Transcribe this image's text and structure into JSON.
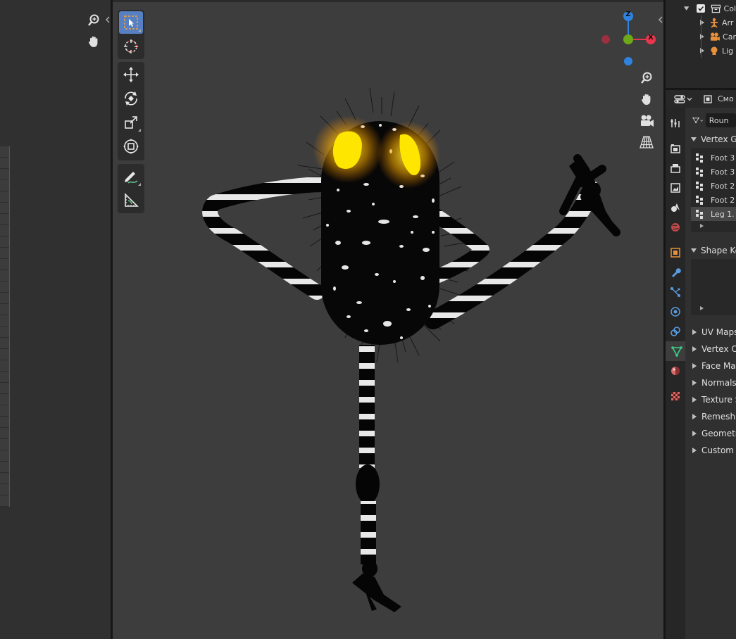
{
  "outliner": {
    "items": [
      {
        "label": "Col",
        "icon": "collection-icon"
      },
      {
        "label": "Arr",
        "icon": "armature-icon"
      },
      {
        "label": "Car",
        "icon": "camera-icon"
      },
      {
        "label": "Lig",
        "icon": "light-icon"
      }
    ]
  },
  "properties": {
    "header_mode": "Смо",
    "mesh_name": "Roun",
    "vertex_groups": {
      "title": "Vertex G",
      "items": [
        "Foot 3",
        "Foot 3",
        "Foot 2",
        "Foot 2",
        "Leg 1."
      ],
      "selected_index": 4
    },
    "shape_keys_title": "Shape Ke",
    "collapsed_panels": [
      "UV Maps",
      "Vertex Co",
      "Face Map",
      "Normals",
      "Texture S",
      "Remesh",
      "Geometr",
      "Custom P"
    ]
  },
  "gizmo": {
    "z_label": "Z",
    "x_label": "X",
    "x_color": "#e8364f",
    "y_color": "#6ea818",
    "z_color": "#2f83e0"
  },
  "colors": {
    "active_tool": "#5680c2",
    "viewport_bg": "#3d3d3d",
    "glow_eyes": "#ffe000"
  }
}
